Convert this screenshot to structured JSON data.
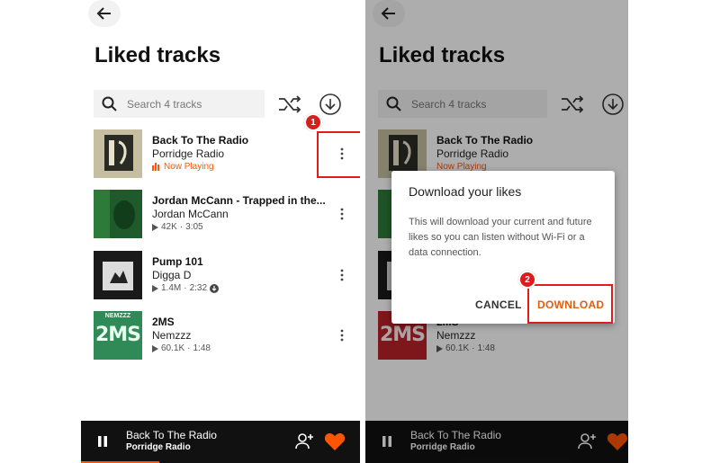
{
  "header": {
    "title": "Liked tracks"
  },
  "search": {
    "placeholder": "Search 4 tracks"
  },
  "tracks": [
    {
      "title": "Back To The Radio",
      "artist": "Porridge Radio",
      "meta": "Now Playing",
      "plays": "",
      "duration": ""
    },
    {
      "title": "Jordan McCann - Trapped in the...",
      "artist": "Jordan McCann",
      "plays": "42K",
      "duration": "3:05"
    },
    {
      "title": "Pump 101",
      "artist": "Digga D",
      "plays": "1.4M",
      "duration": "2:32",
      "downloaded": true
    },
    {
      "title": "2MS",
      "artist": "Nemzzz",
      "plays": "60.1K",
      "duration": "1:48",
      "art_text": "2MS",
      "art_label": "NEMZZZ"
    }
  ],
  "player": {
    "title": "Back To The Radio",
    "artist": "Porridge Radio"
  },
  "dialog": {
    "title": "Download your likes",
    "body": "This will download your current and future likes so you can listen without Wi-Fi or a data connection.",
    "cancel": "CANCEL",
    "confirm": "DOWNLOAD"
  },
  "annotations": {
    "step1": "1",
    "step2": "2"
  },
  "colors": {
    "accent": "#ff5500",
    "highlight": "#e31b1b",
    "player_bg": "#111111"
  },
  "icons": [
    "back-arrow-icon",
    "search-icon",
    "shuffle-icon",
    "download-icon",
    "more-vert-icon",
    "play-icon",
    "pause-icon",
    "add-user-icon",
    "heart-icon"
  ]
}
